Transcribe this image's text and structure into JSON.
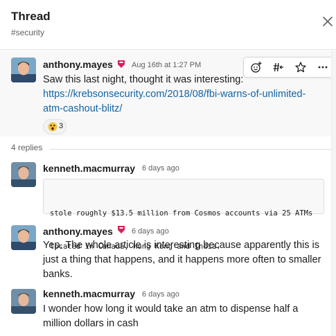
{
  "header": {
    "title": "Thread",
    "channel": "#security",
    "close_icon": "close-icon"
  },
  "parent_message": {
    "author": "anthony.mayes",
    "badge_icon": "team-badge-icon",
    "time": "Aug 16th at 1:27 PM",
    "text": "Saw this last night, thought it was interesting:",
    "link": "https://krebsonsecurity.com/2018/08/fbi-warns-of-unlimited-atm-cashout-blitz/",
    "link_line1": "https://krebsonsecurity.com/2018/08/fbi-warns-of-unlimited-",
    "link_line2": "atm-cashout-blitz/",
    "reaction": {
      "icon": "astonished-face-icon",
      "count": "3"
    },
    "actions": [
      "add-reaction-icon",
      "start-thread-icon",
      "star-icon",
      "more-actions-icon"
    ]
  },
  "replies": {
    "label": "4 replies",
    "items": [
      {
        "author": "kenneth.macmurray",
        "time": "6 days ago",
        "code_line1": "stole roughly $13.5 million from Cosmos accounts via 25 ATMs",
        "code_line2": "located in Canada, Hong Kong and India."
      },
      {
        "author": "anthony.mayes",
        "time": "6 days ago",
        "line1": "Yep. The whole article is interesting because apparently this is",
        "line2": "just a thing that happens, and it happens more often to smaller",
        "line3": "banks."
      },
      {
        "author": "kenneth.macmurray",
        "time": "6 days ago",
        "line1": "I wonder how long it would take an atm to dispense half a",
        "line2": "million dollars in cash"
      }
    ]
  },
  "colors": {
    "link": "#1264a3",
    "badge": "#e01e5a",
    "text": "#1d1c1d",
    "muted": "#616061"
  }
}
